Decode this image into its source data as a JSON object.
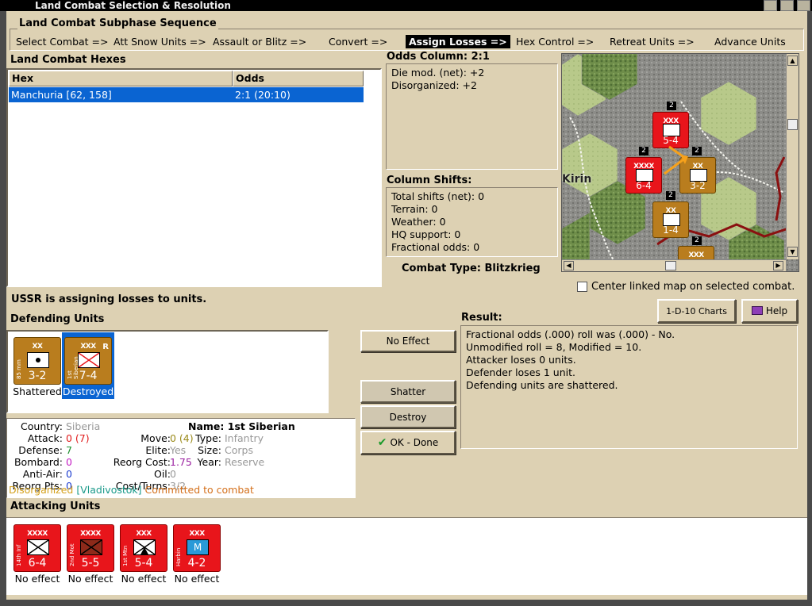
{
  "window": {
    "title": "Land Combat Selection & Resolution"
  },
  "subphase": {
    "title": "Land Combat Subphase Sequence",
    "steps": [
      "Select Combat =>",
      "Att Snow Units =>",
      "Assault or Blitz =>",
      "Convert =>",
      "Assign Losses =>",
      "Hex Control =>",
      "Retreat Units =>",
      "Advance Units"
    ],
    "active_index": 4
  },
  "hexes": {
    "title": "Land Combat Hexes",
    "columns": [
      "Hex",
      "Odds"
    ],
    "rows": [
      {
        "hex": "Manchuria [62, 158]",
        "odds": "2:1 (20:10)"
      }
    ]
  },
  "odds": {
    "title": "Odds Column: 2:1",
    "lines": [
      "Die mod. (net): +2",
      "Disorganized: +2"
    ]
  },
  "shifts": {
    "title": "Column Shifts:",
    "lines": [
      "Total shifts (net): 0",
      "Terrain: 0",
      "Weather: 0",
      "HQ support: 0",
      "Fractional odds: 0"
    ]
  },
  "combat_type": {
    "label": "Combat Type:",
    "value": "Blitzkrieg"
  },
  "map": {
    "place_label": "Kirin",
    "center_checkbox": {
      "label": "Center linked map on selected combat.",
      "checked": false
    },
    "counters": [
      {
        "size": "XXX",
        "str": "5-4",
        "color": "red"
      },
      {
        "size": "XXXX",
        "str": "6-4",
        "color": "red"
      },
      {
        "size": "XX",
        "str": "3-2",
        "color": "gold"
      },
      {
        "size": "XX",
        "str": "1-4",
        "color": "gold"
      },
      {
        "size": "XXX",
        "str": "",
        "color": "gold"
      }
    ],
    "stack_counts": [
      "2",
      "2",
      "2",
      "2",
      "2"
    ]
  },
  "status": "USSR is assigning losses to units.",
  "buttons": {
    "charts": "1-D-10 Charts",
    "help": "Help",
    "no_effect": "No Effect",
    "shatter": "Shatter",
    "destroy": "Destroy",
    "ok_done": "OK - Done"
  },
  "defending": {
    "title": "Defending Units",
    "units": [
      {
        "size": "XX",
        "name": "85 mm",
        "str": "3-2",
        "status": "Shattered",
        "selected": false
      },
      {
        "size": "XXX",
        "name": "1st Siberian",
        "str": "7-4",
        "status": "Destroyed",
        "selected": true,
        "tag": "R"
      }
    ]
  },
  "result": {
    "title": "Result:",
    "lines": [
      "Fractional odds (.000) roll was (.000)  - No.",
      "Unmodified roll = 8, Modified = 10.",
      "Attacker loses 0 units.",
      "Defender loses 1 unit.",
      "Defending units are shattered."
    ]
  },
  "info": {
    "country_label": "Country:",
    "country": "Siberia",
    "name_label": "Name:",
    "name": "1st Siberian",
    "attack_label": "Attack:",
    "attack": "0 (7)",
    "defense_label": "Defense:",
    "defense": "7",
    "bombard_label": "Bombard:",
    "bombard": "0",
    "antiair_label": "Anti-Air:",
    "antiair": "0",
    "reorgpts_label": "Reorg Pts:",
    "reorgpts": "0",
    "move_label": "Move:",
    "move": "0 (4)",
    "elite_label": "Elite:",
    "elite": "Yes",
    "reorgcost_label": "Reorg Cost:",
    "reorgcost": "1.75",
    "oil_label": "Oil:",
    "oil": "0",
    "costturns_label": "Cost/Turns:",
    "costturns": "3/2",
    "type_label": "Type:",
    "type": "Infantry",
    "size_label": "Size:",
    "size": "Corps",
    "year_label": "Year:",
    "year": "Reserve",
    "status1": "Disorganized",
    "status2": "[Vladivostok]",
    "status3": "Committed to combat"
  },
  "attacking": {
    "title": "Attacking Units",
    "units": [
      {
        "size": "XXXX",
        "name": "14th Inf",
        "str": "6-4",
        "status": "No effect"
      },
      {
        "size": "XXXX",
        "name": "2nd Mot",
        "str": "5-5",
        "status": "No effect"
      },
      {
        "size": "XXX",
        "name": "1st Mtn",
        "str": "5-4",
        "status": "No effect"
      },
      {
        "size": "XXX",
        "name": "Harbin",
        "str": "4-2",
        "status": "No effect"
      }
    ]
  },
  "colors": {
    "panel": "#ddd1b3",
    "selection": "#0a64d2",
    "soviet": "#e8151b",
    "japan": "#b97d1e"
  }
}
